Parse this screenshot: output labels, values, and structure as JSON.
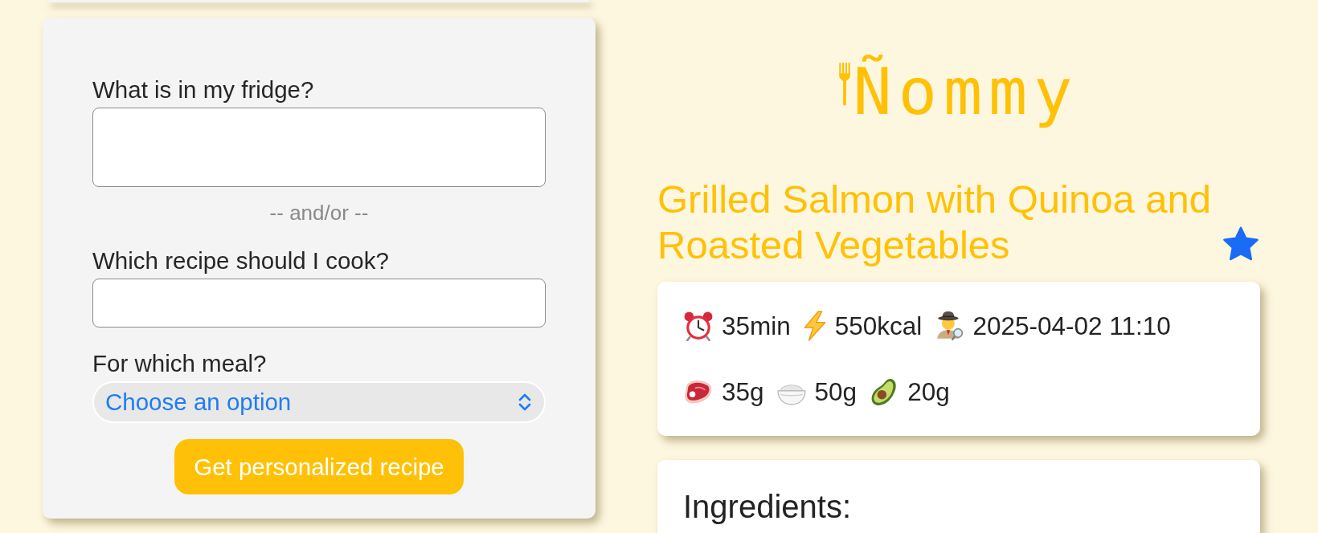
{
  "form": {
    "fields": [
      {
        "kind": "textarea",
        "label": "What is in my fridge?"
      },
      {
        "kind": "separator",
        "text": "-- and/or --"
      },
      {
        "kind": "text",
        "label": "Which recipe should I cook?"
      },
      {
        "kind": "select",
        "label": "For which meal?",
        "placeholder": "Choose an option"
      }
    ],
    "submit_button": "Get personalized recipe"
  },
  "logo": {
    "text": "Ñommy"
  },
  "recipe": {
    "title": "Grilled Salmon with Quinoa and Roasted Vegetables",
    "favorite": true,
    "stat_rows": [
      {
        "items": [
          {
            "kind": "time",
            "text": "35min"
          },
          {
            "kind": "calories",
            "text": "550kcal"
          },
          {
            "kind": "created",
            "text": "2025-04-02 11:10"
          }
        ]
      },
      {
        "items": [
          {
            "kind": "protein",
            "text": "35g"
          },
          {
            "kind": "carbs",
            "text": "50g"
          },
          {
            "kind": "fat",
            "text": "20g"
          }
        ]
      }
    ],
    "ingredients": {
      "heading": "Ingredients:"
    }
  }
}
